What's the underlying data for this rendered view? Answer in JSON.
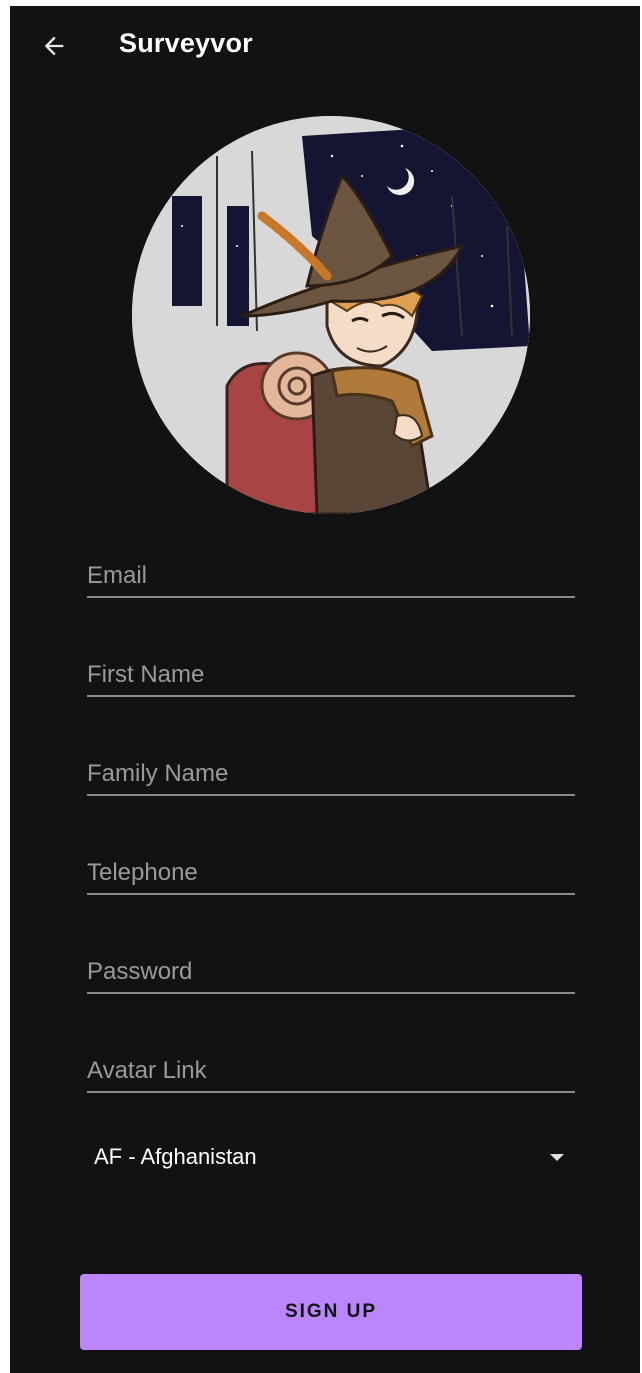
{
  "app": {
    "title": "Surveyvor",
    "back_icon": "arrow-back-icon"
  },
  "avatar": {
    "description": "profile-avatar-illustration"
  },
  "form": {
    "email_placeholder": "Email",
    "first_name_placeholder": "First Name",
    "family_name_placeholder": "Family Name",
    "telephone_placeholder": "Telephone",
    "password_placeholder": "Password",
    "avatar_link_placeholder": "Avatar Link",
    "country_selected": "AF - Afghanistan",
    "signup_label": "SIGN UP"
  },
  "colors": {
    "background": "#121212",
    "accent": "#bb86fc",
    "text": "#ffffff",
    "hint": "#9a9a9a"
  }
}
